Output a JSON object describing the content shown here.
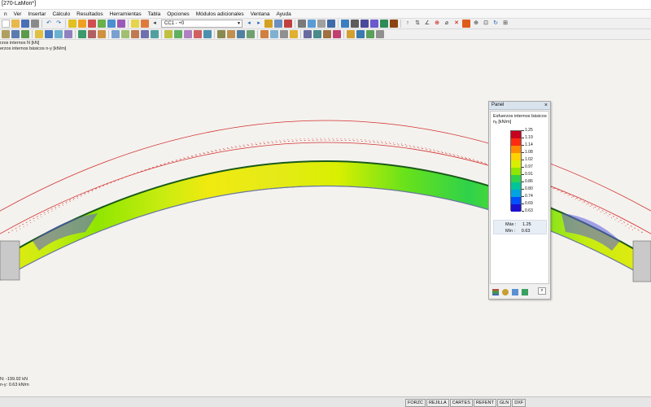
{
  "window": {
    "title": "[270-LaMon*]"
  },
  "menu": [
    "n",
    "Ver",
    "Insertar",
    "Cálculo",
    "Resultados",
    "Herramientas",
    "Tabla",
    "Opciones",
    "Módulos adicionales",
    "Ventana",
    "Ayuda"
  ],
  "toolbar": {
    "load_case": "CC1 - +0"
  },
  "viewport": {
    "info_top": [
      "rzos internos N [kN]",
      "erzos internos básicos n-y [kN/m]"
    ],
    "info_bottom": [
      "N: -199.92 kN",
      "n-y: 0.63 kN/m"
    ]
  },
  "panel": {
    "title": "Panel",
    "close": "×",
    "subtitle": "Esfuerzos internos básicos",
    "unit": "nᵧ [kN/m]",
    "scale_labels": [
      "1.25",
      "1.19",
      "1.14",
      "1.08",
      "1.02",
      "0.97",
      "0.91",
      "0.86",
      "0.80",
      "0.74",
      "0.69",
      "0.63"
    ],
    "scale_colors": [
      "#c8001e",
      "#ff2a10",
      "#ff8a00",
      "#ffd200",
      "#d9ef00",
      "#8fe600",
      "#2fd24a",
      "#00c59a",
      "#00a4e0",
      "#0050ff",
      "#1c10d0"
    ],
    "max_label": "Máx :",
    "max_value": "1.25",
    "min_label": "Mín :",
    "min_value": "0.63"
  },
  "statusbar": {
    "tabs": [
      "FORZC",
      "REJILLA",
      "CARTES",
      "REFENT",
      "GLN",
      "DXF"
    ]
  }
}
